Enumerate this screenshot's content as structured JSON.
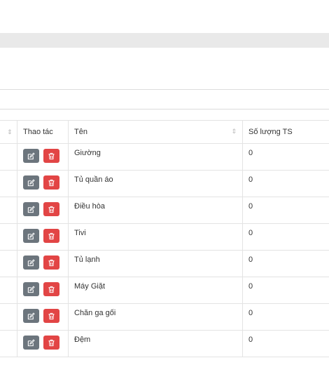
{
  "table": {
    "columns": {
      "actions": "Thao tác",
      "name": "Tên",
      "quantity": "Số lượng TS"
    },
    "rows": [
      {
        "name": "Giường",
        "quantity": "0"
      },
      {
        "name": "Tủ quần áo",
        "quantity": "0"
      },
      {
        "name": "Điều hòa",
        "quantity": "0"
      },
      {
        "name": "Tivi",
        "quantity": "0"
      },
      {
        "name": "Tủ lạnh",
        "quantity": "0"
      },
      {
        "name": "Máy Giặt",
        "quantity": "0"
      },
      {
        "name": "Chăn ga gối",
        "quantity": "0"
      },
      {
        "name": "Đệm",
        "quantity": "0"
      }
    ]
  },
  "colors": {
    "edit_button": "#6c757d",
    "delete_button": "#e24545"
  },
  "icons": {
    "edit": "pencil-square-icon",
    "delete": "trash-icon",
    "sort": "sort-icon"
  }
}
